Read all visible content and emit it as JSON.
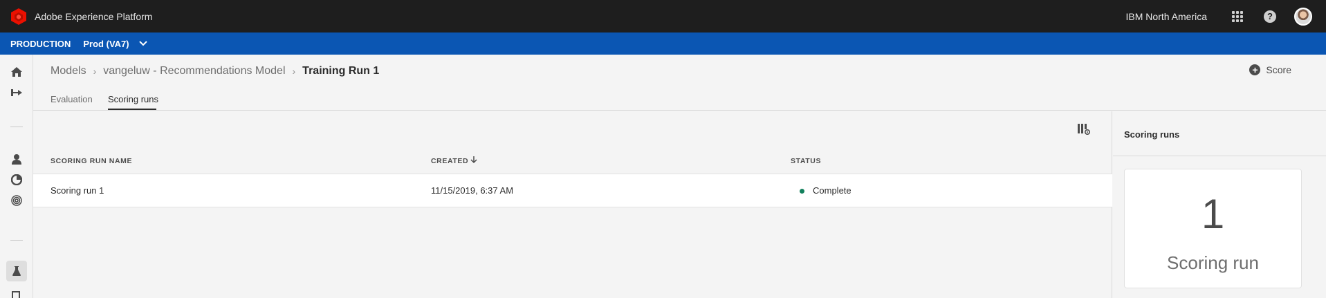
{
  "header": {
    "app_title": "Adobe Experience Platform",
    "org_name": "IBM North America",
    "icons": [
      "adobe-logo",
      "apps-icon",
      "help-icon",
      "avatar"
    ]
  },
  "environment": {
    "label": "PRODUCTION",
    "sandbox": "Prod (VA7)"
  },
  "breadcrumb": {
    "items": [
      "Models",
      "vangeluw - Recommendations Model"
    ],
    "current": "Training Run 1"
  },
  "actions": {
    "score_label": "Score"
  },
  "tabs": [
    {
      "label": "Evaluation",
      "selected": false
    },
    {
      "label": "Scoring runs",
      "selected": true
    }
  ],
  "table": {
    "columns": [
      "SCORING RUN NAME",
      "CREATED",
      "STATUS"
    ],
    "sort": {
      "column": "CREATED",
      "direction": "descending"
    },
    "rows": [
      {
        "name": "Scoring run 1",
        "created": "11/15/2019, 6:37 AM",
        "status": "Complete"
      }
    ]
  },
  "panel": {
    "title": "Scoring runs",
    "count": "1",
    "count_label": "Scoring run"
  },
  "colors": {
    "topbar": "#1e1e1e",
    "envbar": "#0b56b3",
    "status_complete": "#12805c",
    "adobe_red": "#eb1000"
  }
}
